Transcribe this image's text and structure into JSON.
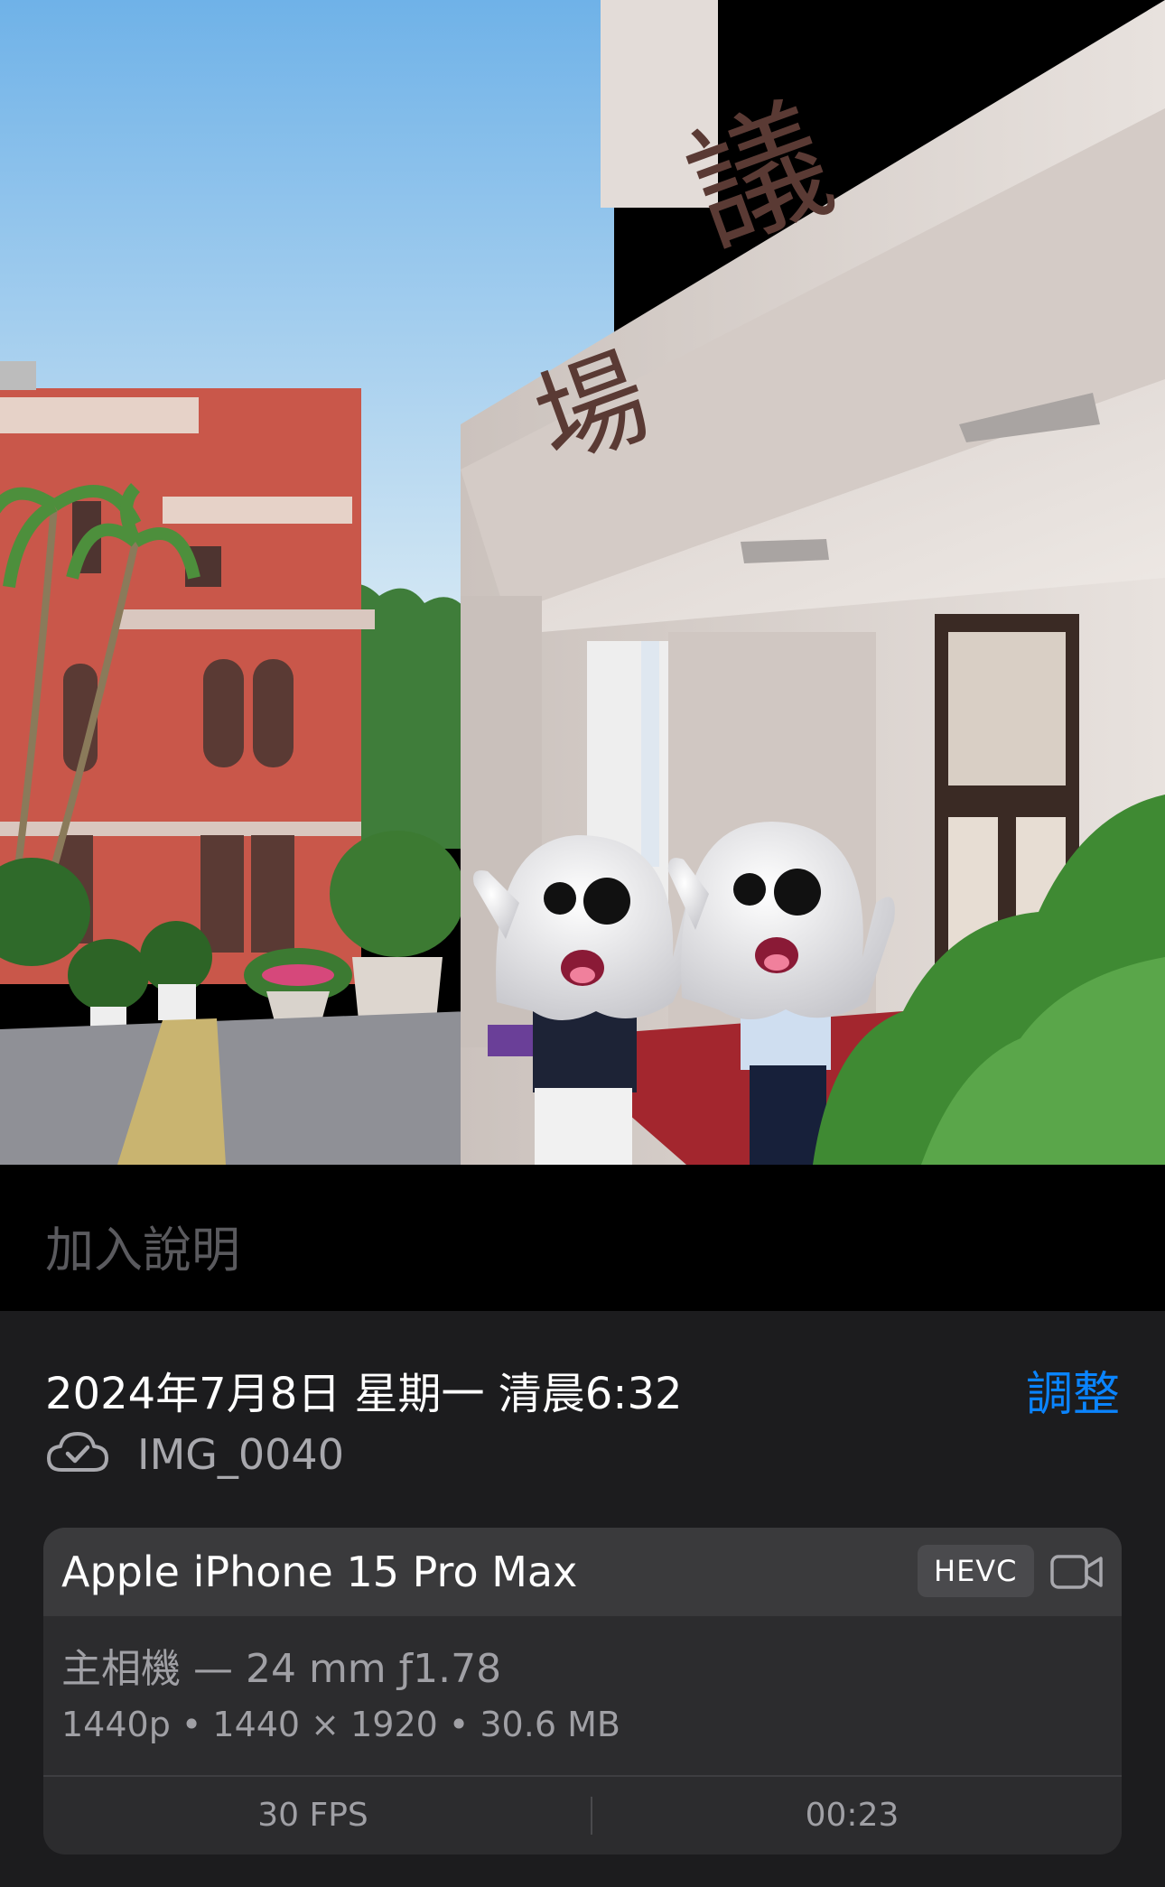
{
  "photo": {
    "sign_chars": [
      "議",
      "場"
    ]
  },
  "caption": {
    "placeholder": "加入說明"
  },
  "info": {
    "datetime": "2024年7月8日 星期一 清晨6:32",
    "adjust_label": "調整",
    "cloud_icon": "icloud-check-icon",
    "filename": "IMG_0040"
  },
  "camera_card": {
    "device": "Apple iPhone 15 Pro Max",
    "codec_badge": "HEVC",
    "video_icon": "video-camera-icon",
    "lens": "主相機 — 24 mm ƒ1.78",
    "specs": "1440p • 1440 × 1920 • 30.6 MB",
    "fps": "30 FPS",
    "duration": "00:23"
  },
  "colors": {
    "accent": "#0a84ff",
    "panel_bg": "#1c1c1e",
    "card_bg": "#2c2c2e",
    "card_header_bg": "#3a3a3c"
  }
}
